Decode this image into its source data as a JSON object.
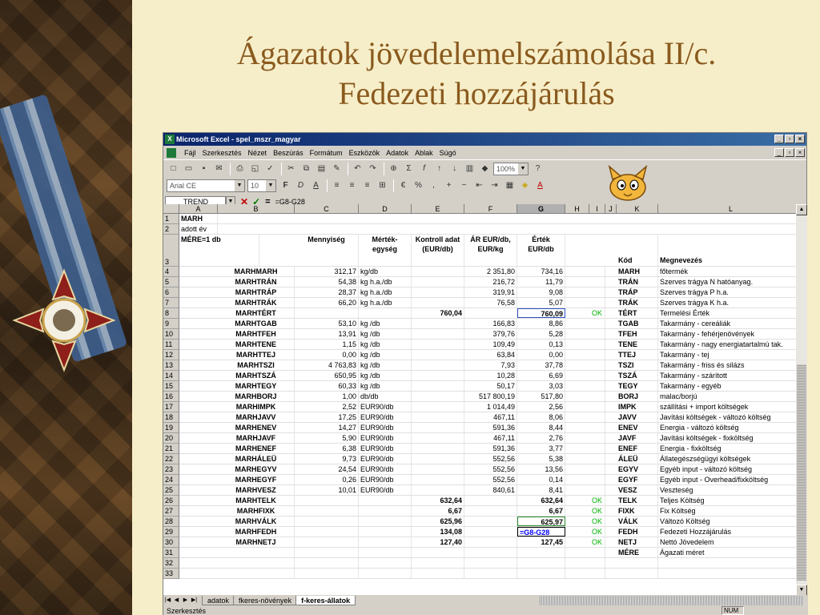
{
  "slide": {
    "title_line1": "Ágazatok jövedelemelszámolása II/c.",
    "title_line2": "Fedezeti hozzájárulás"
  },
  "excel": {
    "window_title": "Microsoft Excel - spel_mszr_magyar",
    "menu": [
      "Fájl",
      "Szerkesztés",
      "Nézet",
      "Beszúrás",
      "Formátum",
      "Eszközök",
      "Adatok",
      "Ablak",
      "Súgó"
    ],
    "font_name": "Arial CE",
    "font_size": "10",
    "zoom": "100%",
    "name_box": "TREND",
    "formula": "=G8-G28",
    "columns": [
      "A",
      "B",
      "C",
      "D",
      "E",
      "F",
      "G",
      "H",
      "I",
      "J",
      "K",
      "L"
    ],
    "row1": {
      "num": "1",
      "a": "MARH"
    },
    "row2": {
      "num": "2",
      "a": "adott év"
    },
    "header": {
      "a": "MÉRE=1 db",
      "c": "Mennyiség",
      "d": "Mérték-egység",
      "e": "Kontroll adat (EUR/db)",
      "f": "ÁR EUR/db, EUR/kg",
      "g": "Érték EUR/db",
      "k": "Kód",
      "l": "Megnevezés",
      "num": "3"
    },
    "rows": [
      {
        "num": "4",
        "b": "MARHMARH",
        "c": "312,17",
        "d": "kg/db",
        "e": "",
        "f": "2 351,80",
        "g": "734,16",
        "i": "",
        "k": "MARH",
        "l": "főtermék"
      },
      {
        "num": "5",
        "b": "MARHTRÁN",
        "c": "54,38",
        "d": "kg h.a./db",
        "e": "",
        "f": "216,72",
        "g": "11,79",
        "i": "",
        "k": "TRÁN",
        "l": "Szerves trágya N hatóanyag."
      },
      {
        "num": "6",
        "b": "MARHTRÁP",
        "c": "28,37",
        "d": "kg h.a./db",
        "e": "",
        "f": "319,91",
        "g": "9,08",
        "i": "",
        "k": "TRÁP",
        "l": "Szerves trágya P h.a."
      },
      {
        "num": "7",
        "b": "MARHTRÁK",
        "c": "66,20",
        "d": "kg h.a./db",
        "e": "",
        "f": "76,58",
        "g": "5,07",
        "i": "",
        "k": "TRÁK",
        "l": "Szerves trágya K h.a."
      },
      {
        "num": "8",
        "b": "MARHTÉRT",
        "c": "",
        "d": "",
        "e": "760,04",
        "f": "",
        "g": "760,09",
        "i": "OK",
        "k": "TÉRT",
        "l": "Termelési Érték"
      },
      {
        "num": "9",
        "b": "MARHTGAB",
        "c": "53,10",
        "d": "kg /db",
        "e": "",
        "f": "166,83",
        "g": "8,86",
        "i": "",
        "k": "TGAB",
        "l": "Takarmány - cereáliák"
      },
      {
        "num": "10",
        "b": "MARHTFEH",
        "c": "13,91",
        "d": "kg /db",
        "e": "",
        "f": "379,76",
        "g": "5,28",
        "i": "",
        "k": "TFEH",
        "l": "Takarmány - fehérjenövények"
      },
      {
        "num": "11",
        "b": "MARHTENE",
        "c": "1,15",
        "d": "kg /db",
        "e": "",
        "f": "109,49",
        "g": "0,13",
        "i": "",
        "k": "TENE",
        "l": "Takarmány - nagy energiatartalmú tak."
      },
      {
        "num": "12",
        "b": "MARHTTEJ",
        "c": "0,00",
        "d": "kg /db",
        "e": "",
        "f": "63,84",
        "g": "0,00",
        "i": "",
        "k": "TTEJ",
        "l": "Takarmány - tej"
      },
      {
        "num": "13",
        "b": "MARHTSZI",
        "c": "4 763,83",
        "d": "kg /db",
        "e": "",
        "f": "7,93",
        "g": "37,78",
        "i": "",
        "k": "TSZI",
        "l": "Takarmány - friss és silázs"
      },
      {
        "num": "14",
        "b": "MARHTSZÁ",
        "c": "650,95",
        "d": "kg /db",
        "e": "",
        "f": "10,28",
        "g": "6,69",
        "i": "",
        "k": "TSZÁ",
        "l": "Takarmány - szárított"
      },
      {
        "num": "15",
        "b": "MARHTEGY",
        "c": "60,33",
        "d": "kg /db",
        "e": "",
        "f": "50,17",
        "g": "3,03",
        "i": "",
        "k": "TEGY",
        "l": "Takarmány - egyéb"
      },
      {
        "num": "16",
        "b": "MARHBORJ",
        "c": "1,00",
        "d": "db/db",
        "e": "",
        "f": "517 800,19",
        "g": "517,80",
        "i": "",
        "k": "BORJ",
        "l": "malac/borjú"
      },
      {
        "num": "17",
        "b": "MARHIMPK",
        "c": "2,52",
        "d": "EUR90/db",
        "e": "",
        "f": "1 014,49",
        "g": "2,56",
        "i": "",
        "k": "IMPK",
        "l": "szállítási + import költségek"
      },
      {
        "num": "18",
        "b": "MARHJAVV",
        "c": "17,25",
        "d": "EUR90/db",
        "e": "",
        "f": "467,11",
        "g": "8,06",
        "i": "",
        "k": "JAVV",
        "l": "Javítási költségek - változó költség"
      },
      {
        "num": "19",
        "b": "MARHENEV",
        "c": "14,27",
        "d": "EUR90/db",
        "e": "",
        "f": "591,36",
        "g": "8,44",
        "i": "",
        "k": "ENEV",
        "l": "Energia - változó költség"
      },
      {
        "num": "20",
        "b": "MARHJAVF",
        "c": "5,90",
        "d": "EUR90/db",
        "e": "",
        "f": "467,11",
        "g": "2,76",
        "i": "",
        "k": "JAVF",
        "l": "Javítási költségek - fixköltség"
      },
      {
        "num": "21",
        "b": "MARHENEF",
        "c": "6,38",
        "d": "EUR90/db",
        "e": "",
        "f": "591,36",
        "g": "3,77",
        "i": "",
        "k": "ENEF",
        "l": "Energia - fixköltség"
      },
      {
        "num": "22",
        "b": "MARHÁLEÜ",
        "c": "9,73",
        "d": "EUR90/db",
        "e": "",
        "f": "552,56",
        "g": "5,38",
        "i": "",
        "k": "ÁLEÜ",
        "l": "Állategészségügyi költségek"
      },
      {
        "num": "23",
        "b": "MARHEGYV",
        "c": "24,54",
        "d": "EUR90/db",
        "e": "",
        "f": "552,56",
        "g": "13,56",
        "i": "",
        "k": "EGYV",
        "l": "Egyéb input - változó költség"
      },
      {
        "num": "24",
        "b": "MARHEGYF",
        "c": "0,26",
        "d": "EUR90/db",
        "e": "",
        "f": "552,56",
        "g": "0,14",
        "i": "",
        "k": "EGYF",
        "l": "Egyéb input - Overhead/fixköltség"
      },
      {
        "num": "25",
        "b": "MARHVESZ",
        "c": "10,01",
        "d": "EUR90/db",
        "e": "",
        "f": "840,61",
        "g": "8,41",
        "i": "",
        "k": "VESZ",
        "l": "Veszteség"
      },
      {
        "num": "26",
        "b": "MARHTELK",
        "c": "",
        "d": "",
        "e": "632,64",
        "f": "",
        "g": "632,64",
        "i": "OK",
        "k": "TELK",
        "l": "Teljes Költség"
      },
      {
        "num": "27",
        "b": "MARHFIXK",
        "c": "",
        "d": "",
        "e": "6,67",
        "f": "",
        "g": "6,67",
        "i": "OK",
        "k": "FIXK",
        "l": "Fix Költség"
      },
      {
        "num": "28",
        "b": "MARHVÁLK",
        "c": "",
        "d": "",
        "e": "625,96",
        "f": "",
        "g": "625,97",
        "i": "OK",
        "k": "VÁLK",
        "l": "Változó Költség"
      },
      {
        "num": "29",
        "b": "MARHFEDH",
        "c": "",
        "d": "",
        "e": "134,08",
        "f": "",
        "g": "=G8-G28",
        "i": "OK",
        "k": "FEDH",
        "l": "Fedezeti Hozzájárulás"
      },
      {
        "num": "30",
        "b": "MARHNETJ",
        "c": "",
        "d": "",
        "e": "127,40",
        "f": "",
        "g": "127,45",
        "i": "OK",
        "k": "NETJ",
        "l": "Nettó Jövedelem"
      },
      {
        "num": "31",
        "b": "",
        "c": "",
        "d": "",
        "e": "",
        "f": "",
        "g": "",
        "i": "",
        "k": "MÉRE",
        "l": "Ágazati méret"
      },
      {
        "num": "32",
        "b": "",
        "c": "",
        "d": "",
        "e": "",
        "f": "",
        "g": "",
        "i": "",
        "k": "",
        "l": ""
      },
      {
        "num": "33",
        "b": "",
        "c": "",
        "d": "",
        "e": "",
        "f": "",
        "g": "",
        "i": "",
        "k": "",
        "l": ""
      }
    ],
    "sheet_tabs": [
      "adatok",
      "fkeres-növények",
      "f-keres-állatok"
    ],
    "active_tab": "f-keres-állatok",
    "status_left": "Szerkesztés",
    "status_num": "NUM"
  }
}
